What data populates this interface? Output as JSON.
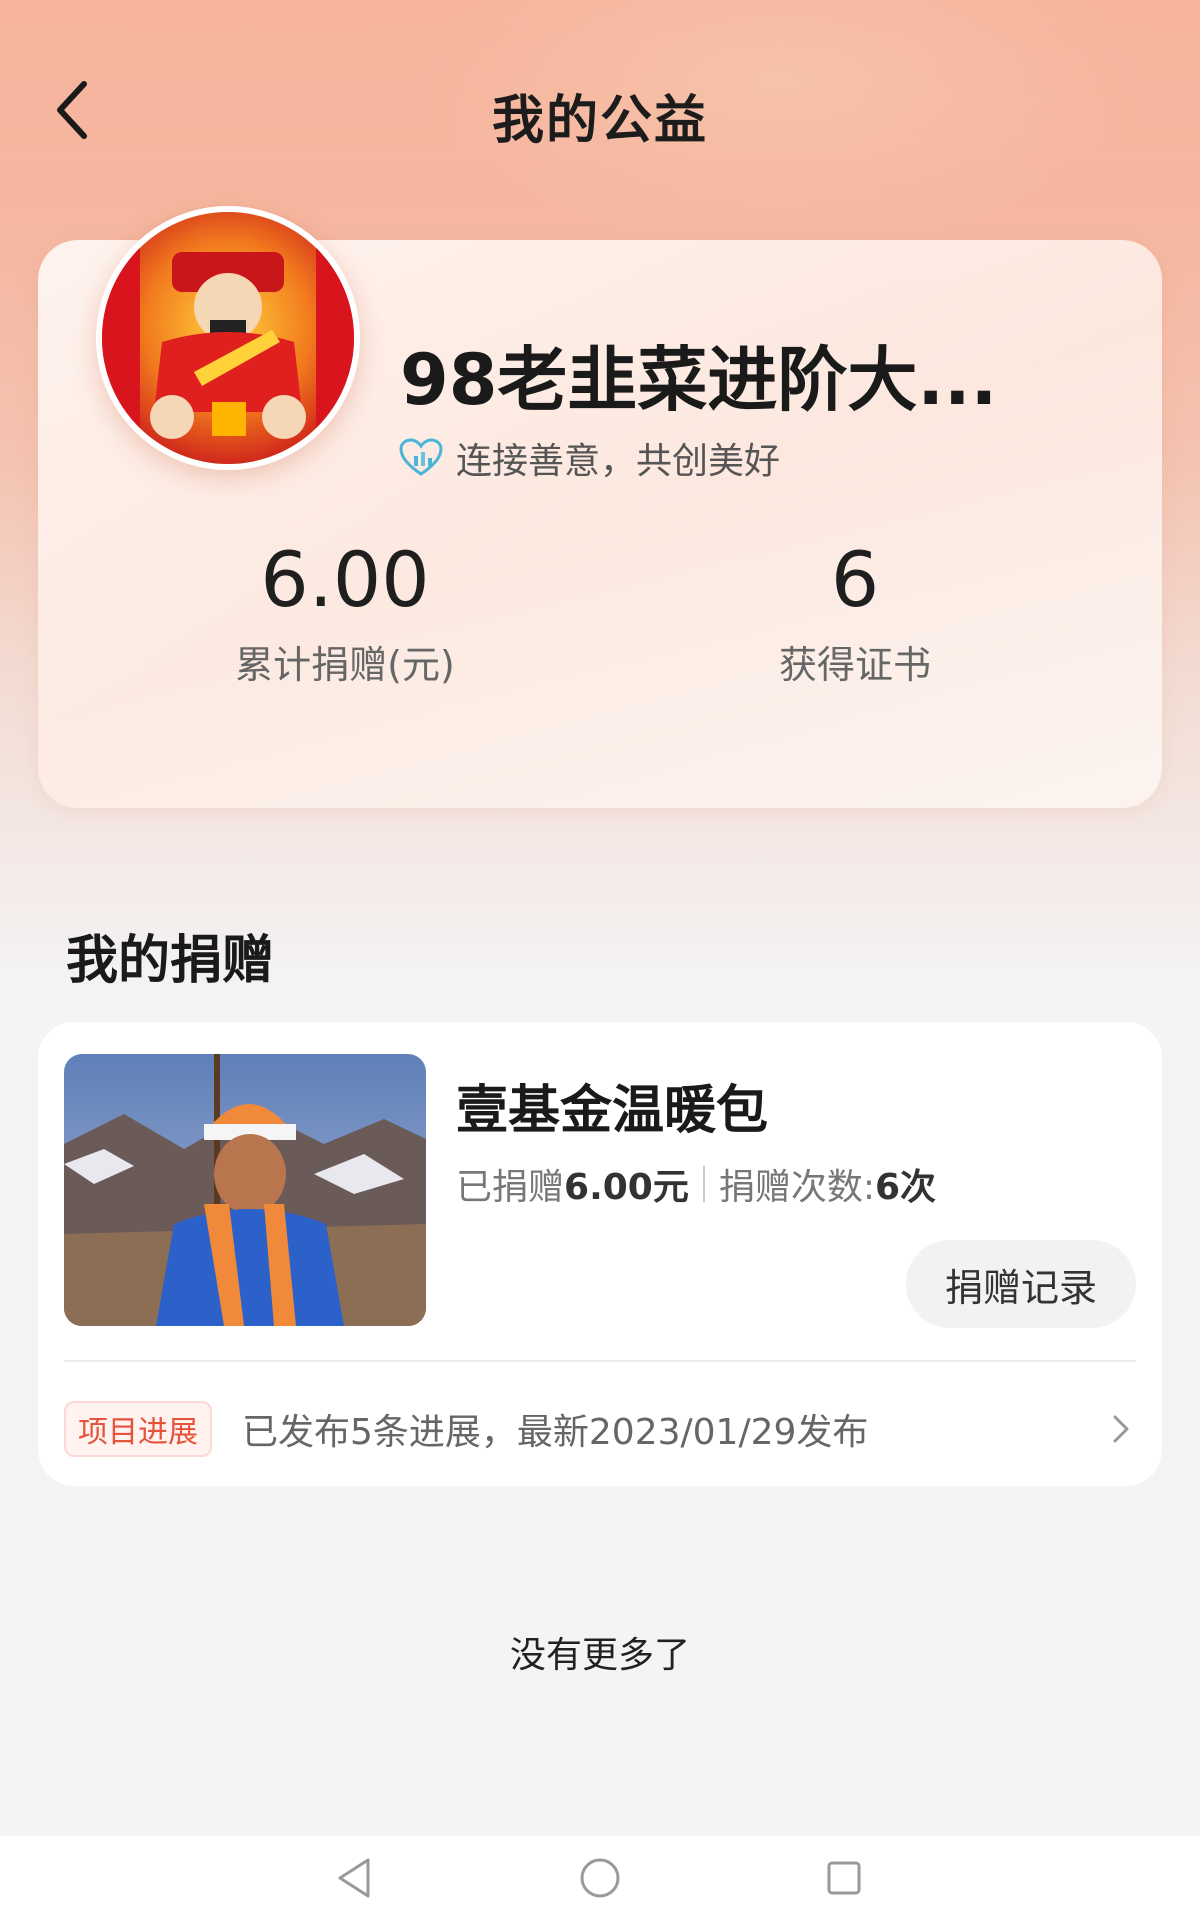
{
  "header": {
    "title": "我的公益"
  },
  "profile": {
    "username": "98老韭菜进阶大...",
    "slogan": "连接善意，共创美好",
    "stats": [
      {
        "value": "6.00",
        "label": "累计捐赠(元)"
      },
      {
        "value": "6",
        "label": "获得证书"
      }
    ]
  },
  "donations": {
    "section_title": "我的捐赠",
    "items": [
      {
        "title": "壹基金温暖包",
        "donated_prefix": "已捐赠",
        "donated_amount": "6.00元",
        "count_prefix": "捐赠次数:",
        "count_value": "6次",
        "record_button": "捐赠记录",
        "progress_badge": "项目进展",
        "progress_text": "已发布5条进展，最新2023/01/29发布"
      }
    ]
  },
  "footer": {
    "no_more": "没有更多了"
  },
  "colors": {
    "accent": "#e5533b",
    "header_bg": "#f7b39c"
  },
  "icons": [
    "back-arrow-icon",
    "heart-chart-icon",
    "chevron-right-icon",
    "nav-back-icon",
    "nav-home-icon",
    "nav-recents-icon"
  ]
}
